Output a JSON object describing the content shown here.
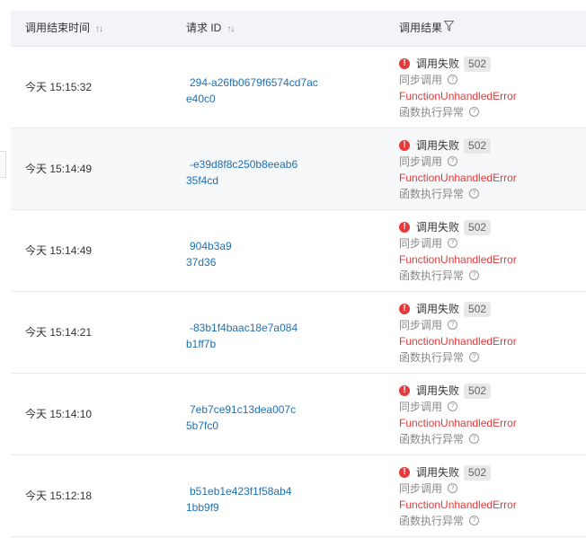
{
  "header": {
    "col_time": "调用结束时间",
    "col_id": "请求 ID",
    "col_result": "调用结果",
    "sort_glyph": "↑↓"
  },
  "icons": {
    "sort": "sort-icon",
    "filter": "filter-icon",
    "error": "error-icon",
    "help": "help-circle-icon"
  },
  "colors": {
    "link": "#1f6fb2",
    "error": "#e5393a",
    "header_bg": "#f2f4f8"
  },
  "rows": [
    {
      "time": "今天 15:15:32",
      "id_line1": "294-a26fb0679f6574cd7ac",
      "id_line2": "e40c0",
      "status": "调用失败",
      "code": "502",
      "sync": "同步调用",
      "error": "FunctionUnhandledError",
      "exception": "函数执行异常"
    },
    {
      "time": "今天 15:14:49",
      "id_line1": "-e39d8f8c250b8eeab6",
      "id_line2": "35f4cd",
      "status": "调用失败",
      "code": "502",
      "sync": "同步调用",
      "error": "FunctionUnhandledError",
      "exception": "函数执行异常"
    },
    {
      "time": "今天 15:14:49",
      "id_line1": "904b3a9",
      "id_line2": "37d36",
      "status": "调用失败",
      "code": "502",
      "sync": "同步调用",
      "error": "FunctionUnhandledError",
      "exception": "函数执行异常"
    },
    {
      "time": "今天 15:14:21",
      "id_line1": "-83b1f4baac18e7a084",
      "id_line2": "b1ff7b",
      "status": "调用失败",
      "code": "502",
      "sync": "同步调用",
      "error": "FunctionUnhandledError",
      "exception": "函数执行异常"
    },
    {
      "time": "今天 15:14:10",
      "id_line1": "7eb7ce91c13dea007c",
      "id_line2": "5b7fc0",
      "status": "调用失败",
      "code": "502",
      "sync": "同步调用",
      "error": "FunctionUnhandledError",
      "exception": "函数执行异常"
    },
    {
      "time": "今天 15:12:18",
      "id_line1": "b51eb1e423f1f58ab4",
      "id_line2": "1bb9f9",
      "status": "调用失败",
      "code": "502",
      "sync": "同步调用",
      "error": "FunctionUnhandledError",
      "exception": "函数执行异常"
    }
  ]
}
